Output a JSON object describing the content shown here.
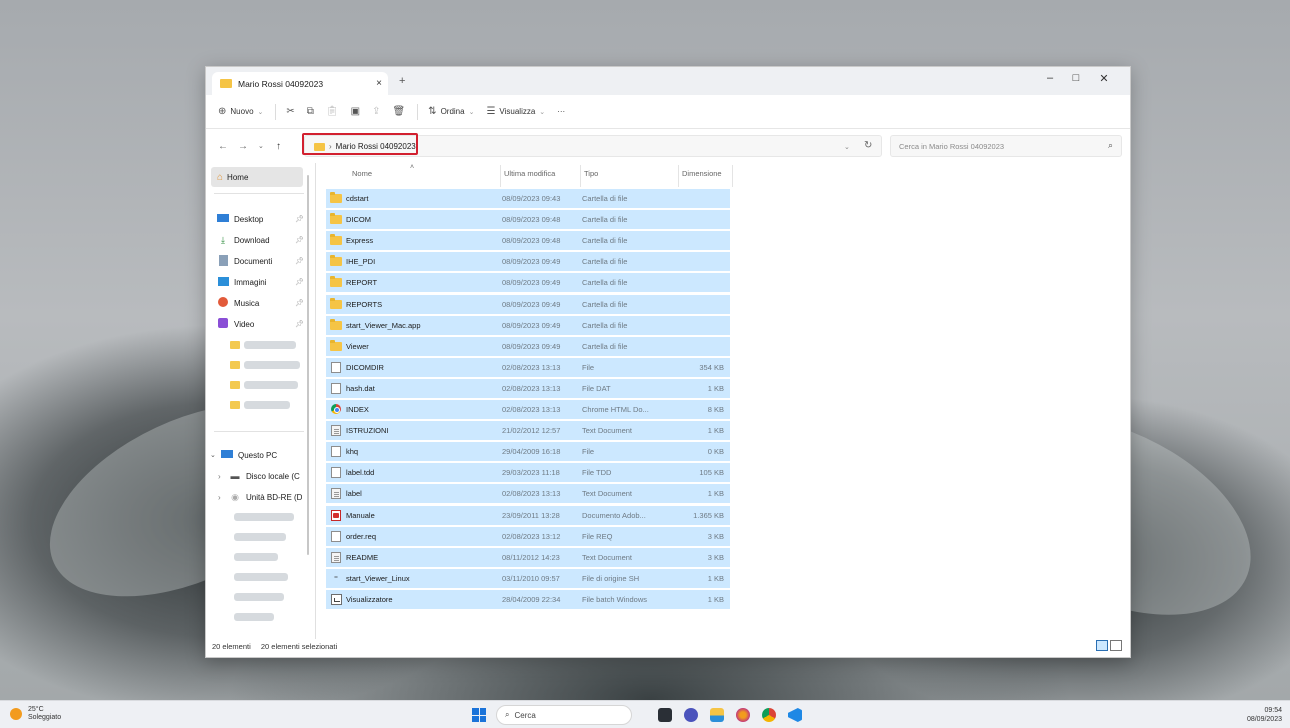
{
  "window": {
    "tab_title": "Mario Rossi 04092023",
    "new_tab": "+",
    "close_tab": "×",
    "controls": {
      "minimize": "–",
      "maximize": "□",
      "close": "✕"
    }
  },
  "toolbar": {
    "new_label": "Nuovo",
    "sort_label": "Ordina",
    "view_label": "Visualizza",
    "more_label": "···"
  },
  "address": {
    "crumb": "Mario Rossi 04092023",
    "search_placeholder": "Cerca in Mario Rossi 04092023"
  },
  "sidebar": {
    "home": "Home",
    "quick": [
      {
        "label": "Desktop",
        "icon": "desktop-icon"
      },
      {
        "label": "Download",
        "icon": "download-icon"
      },
      {
        "label": "Documenti",
        "icon": "documents-icon"
      },
      {
        "label": "Immagini",
        "icon": "pictures-icon"
      },
      {
        "label": "Musica",
        "icon": "music-icon"
      },
      {
        "label": "Video",
        "icon": "video-icon"
      }
    ],
    "this_pc": "Questo PC",
    "drives": [
      "Disco locale (C",
      "Unità BD-RE (D"
    ]
  },
  "columns": {
    "name": "Nome",
    "modified": "Ultima modifica",
    "type": "Tipo",
    "size": "Dimensione"
  },
  "files": [
    {
      "name": "cdstart",
      "date": "08/09/2023 09:43",
      "type": "Cartella di file",
      "size": "",
      "icon": "folder"
    },
    {
      "name": "DICOM",
      "date": "08/09/2023 09:48",
      "type": "Cartella di file",
      "size": "",
      "icon": "folder"
    },
    {
      "name": "Express",
      "date": "08/09/2023 09:48",
      "type": "Cartella di file",
      "size": "",
      "icon": "folder"
    },
    {
      "name": "IHE_PDI",
      "date": "08/09/2023 09:49",
      "type": "Cartella di file",
      "size": "",
      "icon": "folder"
    },
    {
      "name": "REPORT",
      "date": "08/09/2023 09:49",
      "type": "Cartella di file",
      "size": "",
      "icon": "folder"
    },
    {
      "name": "REPORTS",
      "date": "08/09/2023 09:49",
      "type": "Cartella di file",
      "size": "",
      "icon": "folder"
    },
    {
      "name": "start_Viewer_Mac.app",
      "date": "08/09/2023 09:49",
      "type": "Cartella di file",
      "size": "",
      "icon": "folder"
    },
    {
      "name": "Viewer",
      "date": "08/09/2023 09:49",
      "type": "Cartella di file",
      "size": "",
      "icon": "folder"
    },
    {
      "name": "DICOMDIR",
      "date": "02/08/2023 13:13",
      "type": "File",
      "size": "354 KB",
      "icon": "file"
    },
    {
      "name": "hash.dat",
      "date": "02/08/2023 13:13",
      "type": "File DAT",
      "size": "1 KB",
      "icon": "file"
    },
    {
      "name": "INDEX",
      "date": "02/08/2023 13:13",
      "type": "Chrome HTML Do...",
      "size": "8 KB",
      "icon": "chrome"
    },
    {
      "name": "ISTRUZIONI",
      "date": "21/02/2012 12:57",
      "type": "Text Document",
      "size": "1 KB",
      "icon": "doc"
    },
    {
      "name": "khq",
      "date": "29/04/2009 16:18",
      "type": "File",
      "size": "0 KB",
      "icon": "file"
    },
    {
      "name": "label.tdd",
      "date": "29/03/2023 11:18",
      "type": "File TDD",
      "size": "105 KB",
      "icon": "file"
    },
    {
      "name": "label",
      "date": "02/08/2023 13:13",
      "type": "Text Document",
      "size": "1 KB",
      "icon": "doc"
    },
    {
      "name": "Manuale",
      "date": "23/09/2011 13:28",
      "type": "Documento Adob...",
      "size": "1.365 KB",
      "icon": "pdf"
    },
    {
      "name": "order.req",
      "date": "02/08/2023 13:12",
      "type": "File REQ",
      "size": "3 KB",
      "icon": "file"
    },
    {
      "name": "README",
      "date": "08/11/2012 14:23",
      "type": "Text Document",
      "size": "3 KB",
      "icon": "doc"
    },
    {
      "name": "start_Viewer_Linux",
      "date": "03/11/2010 09:57",
      "type": "File di origine SH",
      "size": "1 KB",
      "icon": "sh"
    },
    {
      "name": "Visualizzatore",
      "date": "28/04/2009 22:34",
      "type": "File batch Windows",
      "size": "1 KB",
      "icon": "bat"
    }
  ],
  "status": {
    "items": "20 elementi",
    "selected": "20 elementi selezionati"
  },
  "taskbar": {
    "temperature": "25°C",
    "weather": "Soleggiato",
    "search": "Cerca",
    "time": "09:54",
    "date": "08/09/2023"
  }
}
